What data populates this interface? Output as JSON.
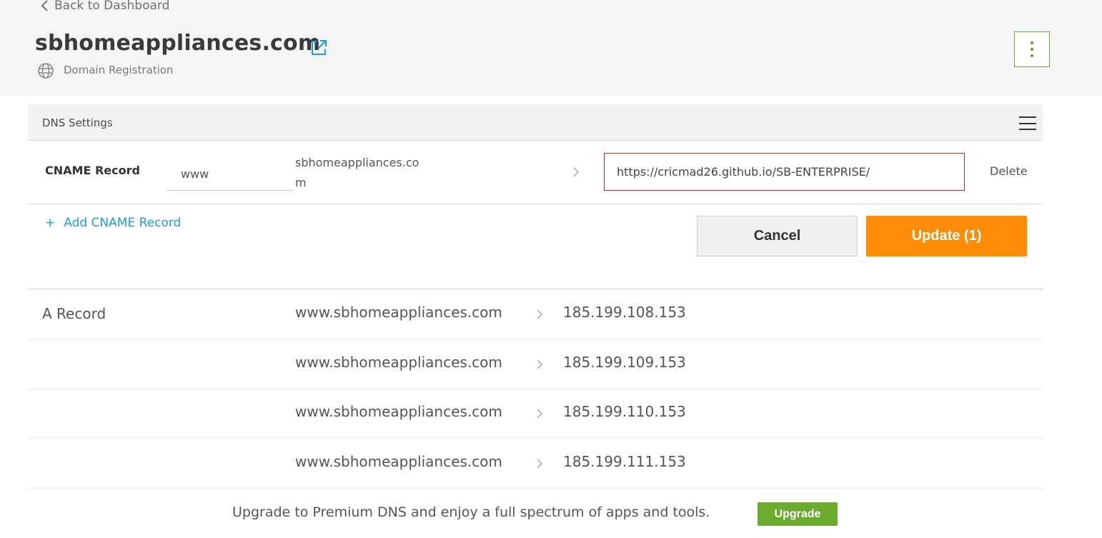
{
  "header": {
    "back_label": "Back to Dashboard",
    "domain": "sbhomeappliances.com",
    "subtitle": "Domain Registration"
  },
  "panel": {
    "title": "DNS Settings"
  },
  "cname": {
    "type_label": "CNAME Record",
    "host_value": "www",
    "domain_suffix": "sbhomeappliances.com",
    "target_value": "https://cricmad26.github.io/SB-ENTERPRISE/",
    "delete_label": "Delete",
    "add_label": "Add CNAME Record",
    "add_prefix": "+"
  },
  "actions": {
    "cancel_label": "Cancel",
    "update_label": "Update (1)"
  },
  "a_records": {
    "type_label": "A Record",
    "rows": [
      {
        "host": "www.sbhomeappliances.com",
        "value": "185.199.108.153"
      },
      {
        "host": "www.sbhomeappliances.com",
        "value": "185.199.109.153"
      },
      {
        "host": "www.sbhomeappliances.com",
        "value": "185.199.110.153"
      },
      {
        "host": "www.sbhomeappliances.com",
        "value": "185.199.111.153"
      }
    ]
  },
  "promo": {
    "text": "Upgrade to Premium DNS and enjoy a full spectrum of apps and tools.",
    "button_label": "Upgrade"
  },
  "colors": {
    "accent_orange": "#ff8c07",
    "accent_green": "#6aaa2c",
    "link_blue": "#1a9fd9",
    "error_red": "#c0272d"
  },
  "icons": {
    "back": "chevron-left-icon",
    "external": "external-link-icon",
    "globe": "globe-icon",
    "menu": "kebab-menu-icon",
    "hamburger": "hamburger-menu-icon",
    "arrow": "chevron-right-icon"
  }
}
